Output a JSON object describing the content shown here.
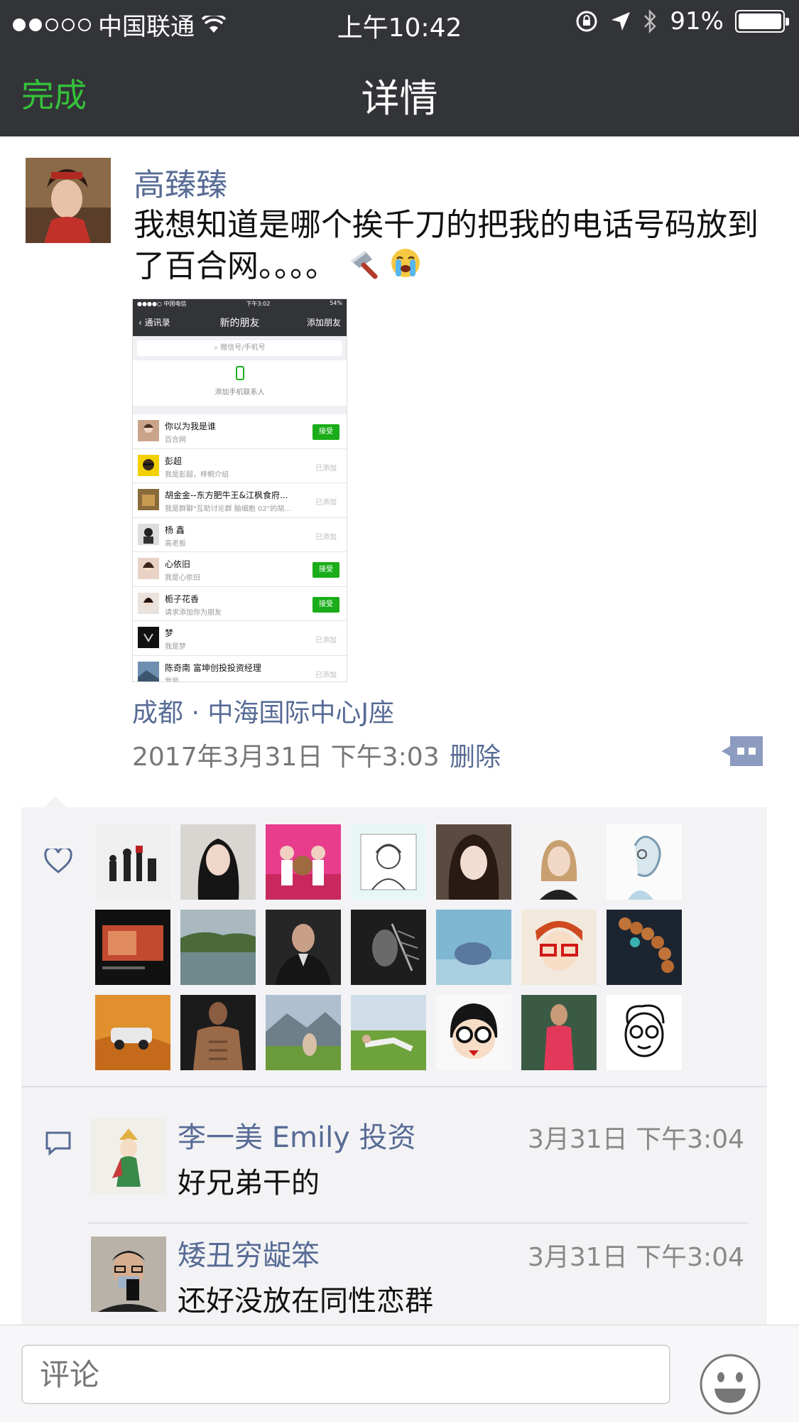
{
  "status_bar": {
    "carrier": "中国联通",
    "time": "上午10:42",
    "battery_percent": "91%",
    "signal_dots_filled": 2,
    "signal_dots_total": 5
  },
  "nav": {
    "done_label": "完成",
    "title": "详情"
  },
  "post": {
    "author": "高臻臻",
    "text": "我想知道是哪个挨千刀的把我的电话号码放到了百合网。。。。",
    "location": "成都 · 中海国际中心J座",
    "timestamp": "2017年3月31日 下午3:03",
    "delete_label": "删除",
    "screenshot": {
      "carrier": "●●●●○ 中国电信",
      "time": "下午3:02",
      "battery": "54%",
      "back_label": "通讯录",
      "title": "新的朋友",
      "add_label": "添加朋友",
      "search_placeholder": "微信号/手机号",
      "add_contacts_label": "添加手机联系人",
      "accept_label": "接受",
      "added_label": "已添加",
      "rows": [
        {
          "name": "你以为我是谁",
          "desc": "百合网",
          "state": "accept"
        },
        {
          "name": "彭超",
          "desc": "我是彭超，梓桐介绍",
          "state": "added"
        },
        {
          "name": "胡金金--东方肥牛王&江枫食府...",
          "desc": "我是群聊\"互助讨论群 脑细胞 02\"的胡...",
          "state": "added"
        },
        {
          "name": "杨 鑫",
          "desc": "高老板",
          "state": "added"
        },
        {
          "name": "心依旧",
          "desc": "我是心依旧",
          "state": "accept"
        },
        {
          "name": "栀子花香",
          "desc": "请求添加你为朋友",
          "state": "accept"
        },
        {
          "name": "梦",
          "desc": "我是梦",
          "state": "added"
        },
        {
          "name": "陈奇南 富坤创投投资经理",
          "desc": "我是...",
          "state": "added"
        }
      ]
    }
  },
  "likes": {
    "count": 21
  },
  "comments": [
    {
      "name": "李一美 Emily 投资",
      "time": "3月31日 下午3:04",
      "text": "好兄弟干的"
    },
    {
      "name": "矮丑穷龊笨",
      "time": "3月31日 下午3:04",
      "text": "还好没放在同性恋群"
    }
  ],
  "comment_input": {
    "placeholder": "评论"
  },
  "colors": {
    "nav_bg": "#333438",
    "accent_green": "#35c13a",
    "link_blue": "#576b95",
    "panel_bg": "#f3f3f5"
  }
}
